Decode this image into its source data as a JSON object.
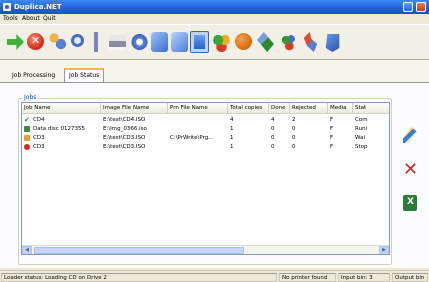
{
  "window": {
    "title": "Duplica.NET"
  },
  "menu": [
    "Tools",
    "About",
    "Quit"
  ],
  "toolbar": {
    "buttons": [
      "arrow-right-icon",
      "stop-icon",
      "users-icon",
      "search-icon",
      "cursor-icon",
      "printer-icon",
      "settings-icon",
      "disc-icon",
      "disc-copy-icon",
      "job-status-icon",
      "colors-icon",
      "ball-icon",
      "tools-icon",
      "palette-icon",
      "wrench-icon",
      "cube-icon"
    ]
  },
  "tabs": [
    {
      "label": "Job Processing",
      "active": false
    },
    {
      "label": "Job Status",
      "active": true
    }
  ],
  "group": {
    "label": "Jobs"
  },
  "table": {
    "columns": [
      "Job Name",
      "Image File Name",
      "Prn File Name",
      "Total copies",
      "Done",
      "Rejected",
      "Media",
      "Stat"
    ],
    "rows": [
      {
        "status_icon": "check-icon",
        "cells": [
          "CD4",
          "E:\\test\\CD4.ISO",
          "",
          "4",
          "4",
          "2",
          "F",
          "Com"
        ]
      },
      {
        "status_icon": "printing-icon",
        "cells": [
          "Data disc 0127355",
          "E:\\Img_0366.iso",
          "",
          "1",
          "0",
          "0",
          "F",
          "Runi"
        ]
      },
      {
        "status_icon": "disc-icon",
        "cells": [
          "CD3",
          "E:\\test\\CD3.ISO",
          "C:\\PrWrite\\Prg...",
          "1",
          "0",
          "0",
          "F",
          "Wai"
        ]
      },
      {
        "status_icon": "error-icon",
        "cells": [
          "CD3",
          "E:\\test\\CD3.ISO",
          "",
          "1",
          "0",
          "0",
          "F",
          "Stop"
        ]
      }
    ]
  },
  "side_actions": [
    {
      "name": "edit-job-button",
      "icon": "edit-icon"
    },
    {
      "name": "delete-job-button",
      "icon": "delete-icon"
    },
    {
      "name": "export-excel-button",
      "icon": "excel-icon"
    }
  ],
  "statusbar": {
    "loader": "Loader status: Loading CD on Drive 2",
    "printer": "No printer found",
    "input_bin": "Input bin: 3",
    "output_bin": "Output bin"
  }
}
